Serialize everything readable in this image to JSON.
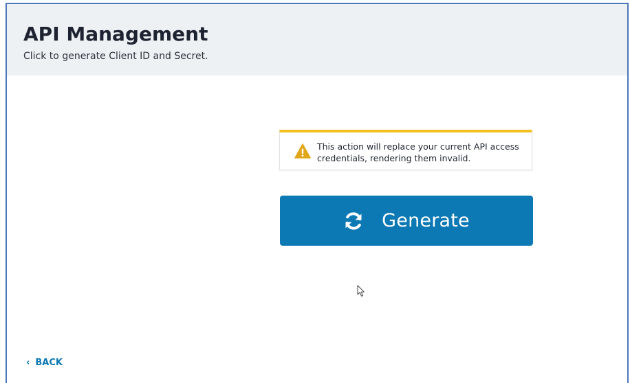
{
  "header": {
    "title": "API Management",
    "subtitle": "Click to generate Client ID and Secret."
  },
  "warning": {
    "icon": "warning-icon",
    "text": "This action will replace your current API access credentials, rendering them invalid.",
    "accent_color": "#f2c01f"
  },
  "generate": {
    "icon": "refresh-icon",
    "label": "Generate",
    "color": "#0c78b4"
  },
  "footer": {
    "back_chevron": "‹",
    "back_label": "BACK"
  }
}
